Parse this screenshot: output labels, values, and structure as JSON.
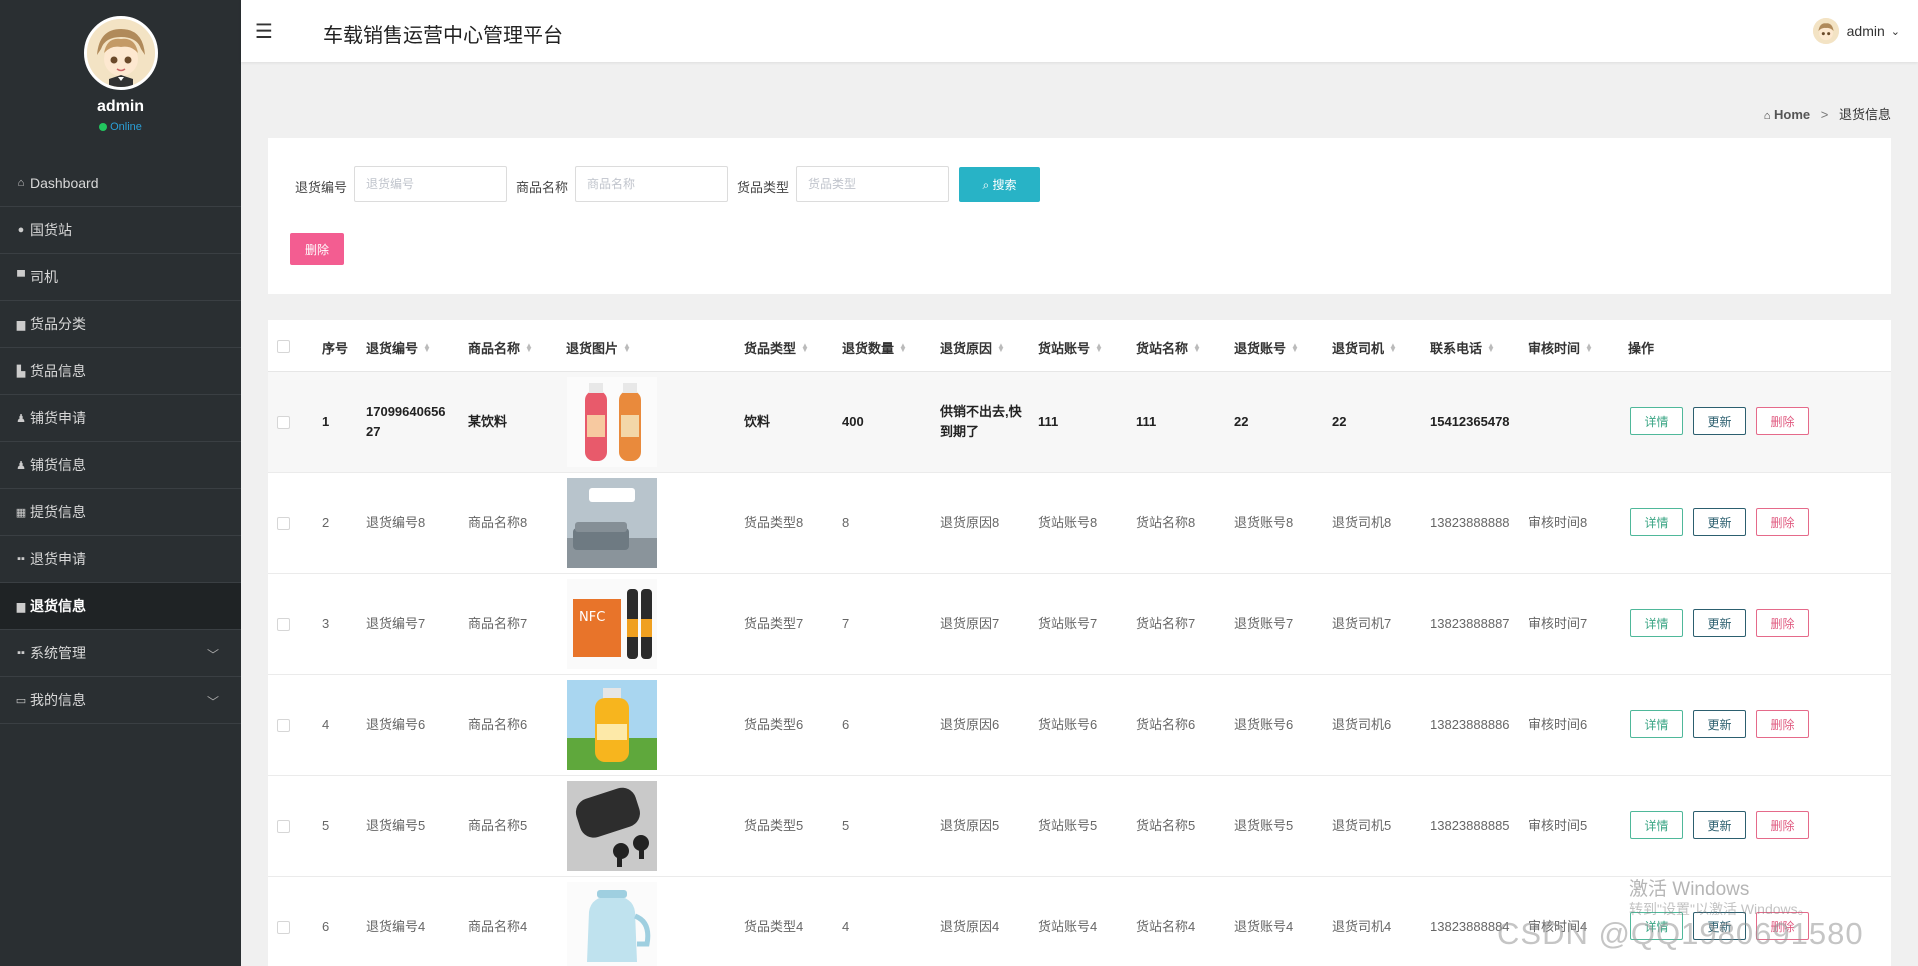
{
  "sidebar": {
    "user_name": "admin",
    "status": "Online",
    "items": [
      {
        "label": "Dashboard",
        "icon": "home-icon"
      },
      {
        "label": "国货站",
        "icon": "location-icon"
      },
      {
        "label": "司机",
        "icon": "comment-icon"
      },
      {
        "label": "货品分类",
        "icon": "briefcase-icon"
      },
      {
        "label": "货品信息",
        "icon": "book-icon"
      },
      {
        "label": "铺货申请",
        "icon": "user-icon"
      },
      {
        "label": "铺货信息",
        "icon": "user-icon"
      },
      {
        "label": "提货信息",
        "icon": "calendar-icon"
      },
      {
        "label": "退货申请",
        "icon": "grid-icon"
      },
      {
        "label": "退货信息",
        "icon": "briefcase-icon",
        "active": true
      },
      {
        "label": "系统管理",
        "icon": "grid-icon",
        "expandable": true
      },
      {
        "label": "我的信息",
        "icon": "card-icon",
        "expandable": true
      }
    ]
  },
  "header": {
    "title": "车载销售运营中心管理平台",
    "user": "admin"
  },
  "breadcrumb": {
    "home": "Home",
    "separator": ">",
    "current": "退货信息"
  },
  "search": {
    "fields": [
      {
        "label": "退货编号",
        "placeholder": "退货编号"
      },
      {
        "label": "商品名称",
        "placeholder": "商品名称"
      },
      {
        "label": "货品类型",
        "placeholder": "货品类型"
      }
    ],
    "search_label": "搜索",
    "delete_label": "删除"
  },
  "table": {
    "columns": [
      "序号",
      "退货编号",
      "商品名称",
      "退货图片",
      "货品类型",
      "退货数量",
      "退货原因",
      "货站账号",
      "货站名称",
      "退货账号",
      "退货司机",
      "联系电话",
      "审核时间",
      "操作"
    ],
    "actions": {
      "detail": "详情",
      "update": "更新",
      "delete": "删除"
    },
    "rows": [
      {
        "no": "1",
        "code": "1709964065627",
        "name": "某饮料",
        "image": "juice-bottles",
        "type": "饮料",
        "qty": "400",
        "reason": "供销不出去,快到期了",
        "station_acct": "111",
        "station_name": "111",
        "return_acct": "22",
        "driver": "22",
        "phone": "15412365478",
        "review_time": ""
      },
      {
        "no": "2",
        "code": "退货编号8",
        "name": "商品名称8",
        "image": "air-conditioner",
        "type": "货品类型8",
        "qty": "8",
        "reason": "退货原因8",
        "station_acct": "货站账号8",
        "station_name": "货站名称8",
        "return_acct": "退货账号8",
        "driver": "退货司机8",
        "phone": "13823888888",
        "review_time": "审核时间8"
      },
      {
        "no": "3",
        "code": "退货编号7",
        "name": "商品名称7",
        "image": "nfc-juice-box",
        "type": "货品类型7",
        "qty": "7",
        "reason": "退货原因7",
        "station_acct": "货站账号7",
        "station_name": "货站名称7",
        "return_acct": "退货账号7",
        "driver": "退货司机7",
        "phone": "13823888887",
        "review_time": "审核时间7"
      },
      {
        "no": "4",
        "code": "退货编号6",
        "name": "商品名称6",
        "image": "orange-juice-bottle",
        "type": "货品类型6",
        "qty": "6",
        "reason": "退货原因6",
        "station_acct": "货站账号6",
        "station_name": "货站名称6",
        "return_acct": "退货账号6",
        "driver": "退货司机6",
        "phone": "13823888886",
        "review_time": "审核时间6"
      },
      {
        "no": "5",
        "code": "退货编号5",
        "name": "商品名称5",
        "image": "earbuds-case",
        "type": "货品类型5",
        "qty": "5",
        "reason": "退货原因5",
        "station_acct": "货站账号5",
        "station_name": "货站名称5",
        "return_acct": "退货账号5",
        "driver": "退货司机5",
        "phone": "13823888885",
        "review_time": "审核时间5"
      },
      {
        "no": "6",
        "code": "退货编号4",
        "name": "商品名称4",
        "image": "electric-kettle",
        "type": "货品类型4",
        "qty": "4",
        "reason": "退货原因4",
        "station_acct": "货站账号4",
        "station_name": "货站名称4",
        "return_acct": "退货账号4",
        "driver": "退货司机4",
        "phone": "13823888884",
        "review_time": "审核时间4"
      }
    ]
  },
  "watermarks": {
    "windows_line1": "激活 Windows",
    "windows_line2": "转到\"设置\"以激活 Windows。",
    "csdn": "CSDN @QQ1980691580"
  },
  "colors": {
    "sidebar_bg": "#2a2f32",
    "search_button": "#28b3c6",
    "delete_button": "#f35d91",
    "detail_border": "#4fb89a",
    "update_border": "#2c5f6f",
    "delete_border": "#e56a8a"
  }
}
